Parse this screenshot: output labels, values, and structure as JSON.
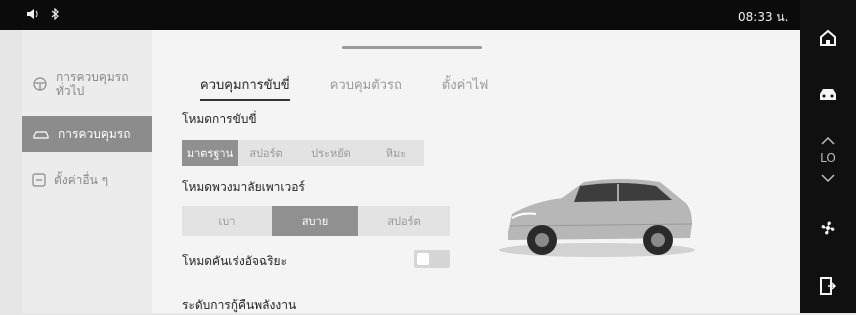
{
  "status_bar": {
    "time": "08:33 น."
  },
  "left_nav": {
    "items": [
      {
        "label": "การควบคุมรถทั่วไป",
        "icon": "steering-wheel-icon",
        "active": false
      },
      {
        "label": "การควบคุมรถ",
        "icon": "car-outline-icon",
        "active": true
      },
      {
        "label": "ตั้งค่าอื่น ๆ",
        "icon": "settings-icon",
        "active": false
      }
    ]
  },
  "main": {
    "tabs": [
      {
        "label": "ควบคุมการขับขี่",
        "active": true
      },
      {
        "label": "ควบคุมตัวรถ",
        "active": false
      },
      {
        "label": "ตั้งค่าไฟ",
        "active": false
      }
    ],
    "drive_mode": {
      "label": "โหมดการขับขี่",
      "options": [
        "มาตรฐาน",
        "สปอร์ต",
        "ประหยัด",
        "หิมะ"
      ],
      "selected": "มาตรฐาน"
    },
    "steering_mode": {
      "label": "โหมดพวงมาลัยเพาเวอร์",
      "options": [
        "เบา",
        "สบาย",
        "สปอร์ต"
      ],
      "selected": "สบาย"
    },
    "smart_pedal": {
      "label": "โหมดคันเร่งอัจฉริยะ",
      "enabled": false
    },
    "energy_recovery": {
      "label": "ระดับการกู้คืนพลังงาน"
    }
  },
  "right_bar": {
    "icons": [
      "home-icon",
      "car-icon",
      "climate-up-icon",
      "climate-down-icon",
      "fan-icon",
      "exit-icon"
    ],
    "climate_level": "LO"
  },
  "colors": {
    "status_bar_bg": "#0b0b0b",
    "right_bar_bg": "#101010",
    "selected_segment": "#909090",
    "active_nav_bg": "#8c8c8c"
  }
}
